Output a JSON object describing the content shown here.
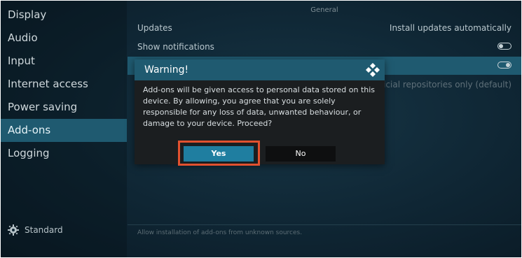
{
  "sidebar": {
    "items": [
      {
        "label": "Display"
      },
      {
        "label": "Audio"
      },
      {
        "label": "Input"
      },
      {
        "label": "Internet access"
      },
      {
        "label": "Power saving"
      },
      {
        "label": "Add-ons"
      },
      {
        "label": "Logging"
      }
    ],
    "active_item": "Add-ons",
    "footer_label": "Standard",
    "footer_icon": "gear-icon"
  },
  "main": {
    "section_title": "General",
    "rows": [
      {
        "label": "Updates",
        "value": "Install updates automatically"
      },
      {
        "label": "Show notifications",
        "toggle": "off"
      },
      {
        "label": "",
        "toggle": "on"
      },
      {
        "label": "",
        "value": "Official repositories only (default)"
      }
    ],
    "help_text": "Allow installation of add-ons from unknown sources."
  },
  "dialog": {
    "title": "Warning!",
    "logo_icon": "kodi-logo-icon",
    "message": "Add-ons will be given access to personal data stored on this device. By allowing, you agree that you are solely responsible for any loss of data, unwanted behaviour, or damage to your device. Proceed?",
    "yes_label": "Yes",
    "no_label": "No"
  },
  "colors": {
    "accent": "#1f5a70",
    "button_focus": "#1f7ea0",
    "annotation_box": "#e2512f",
    "background": "#0f2634"
  }
}
